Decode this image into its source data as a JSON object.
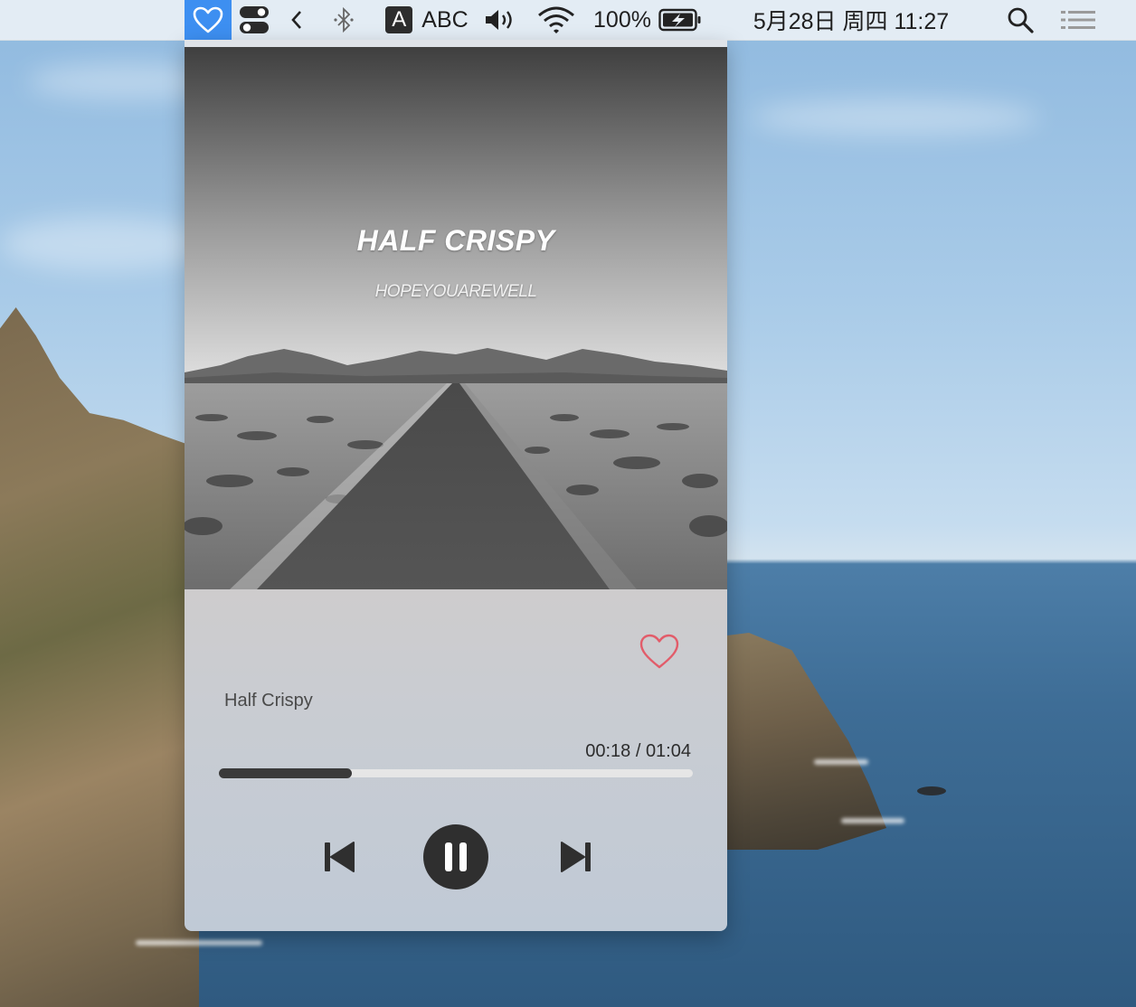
{
  "menubar": {
    "abc_label": "ABC",
    "input_badge": "A",
    "battery": "100%",
    "datetime": "5月28日 周四  11:27",
    "icons": [
      "heart-icon",
      "toggle-icon",
      "chevron-left-icon",
      "bluetooth-icon",
      "keyboard-input-icon",
      "volume-icon",
      "wifi-icon",
      "battery-icon",
      "search-icon",
      "list-icon"
    ]
  },
  "player": {
    "cover_title": "HALF CRISPY",
    "cover_artist": "HOPEYOUAREWELL",
    "track_title": "Half Crispy",
    "time": "00:18 / 01:04",
    "progress": 0.28,
    "liked": true
  },
  "colors": {
    "accent": "#3d8ff1",
    "heart_outline": "#e25c6a",
    "controls": "#2f2f2f"
  }
}
